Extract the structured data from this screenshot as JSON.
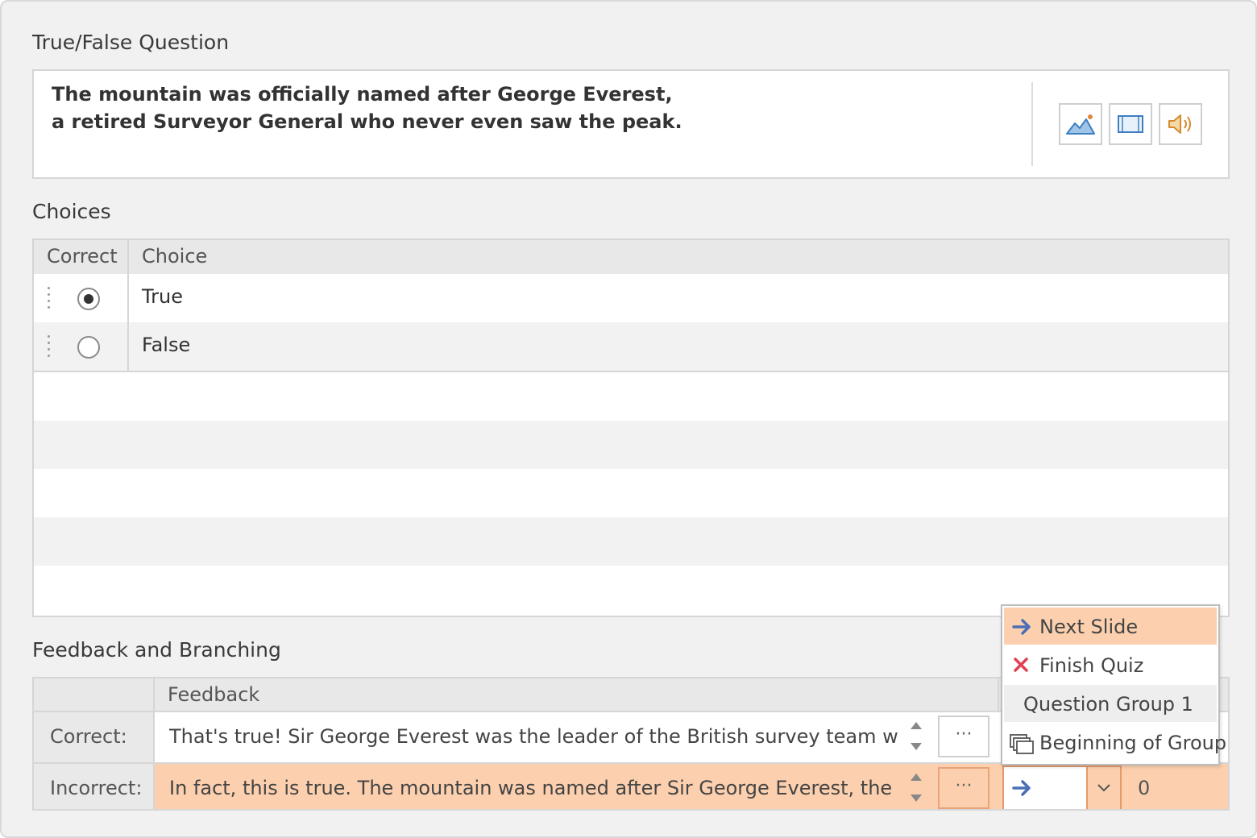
{
  "question": {
    "section_title": "True/False Question",
    "text": "The mountain was officially named after George Everest,\na retired Surveyor General who never even saw the peak.",
    "media_buttons": [
      "image-icon",
      "video-icon",
      "audio-icon"
    ]
  },
  "choices": {
    "section_title": "Choices",
    "headers": {
      "correct": "Correct",
      "choice": "Choice"
    },
    "rows": [
      {
        "label": "True",
        "correct": true
      },
      {
        "label": "False",
        "correct": false
      }
    ]
  },
  "feedback": {
    "section_title": "Feedback and Branching",
    "header": "Feedback",
    "rows": [
      {
        "label": "Correct:",
        "text": "That's true! Sir George Everest was the leader of the British survey team which",
        "more": "···"
      },
      {
        "label": "Incorrect:",
        "text": "In fact, this is true. The mountain was named after Sir George Everest, the",
        "more": "···",
        "score": "0"
      }
    ]
  },
  "branch_dropdown": {
    "items": [
      {
        "label": "Next Slide",
        "icon": "arrow-right-icon",
        "selected": true
      },
      {
        "label": "Finish Quiz",
        "icon": "close-icon"
      },
      {
        "label": "Question Group 1",
        "group": true
      },
      {
        "label": "Beginning of Group",
        "icon": "group-icon"
      }
    ]
  },
  "colors": {
    "selection": "#fcd0ae",
    "arrow": "#4a6fb5",
    "finish": "#e04050"
  }
}
